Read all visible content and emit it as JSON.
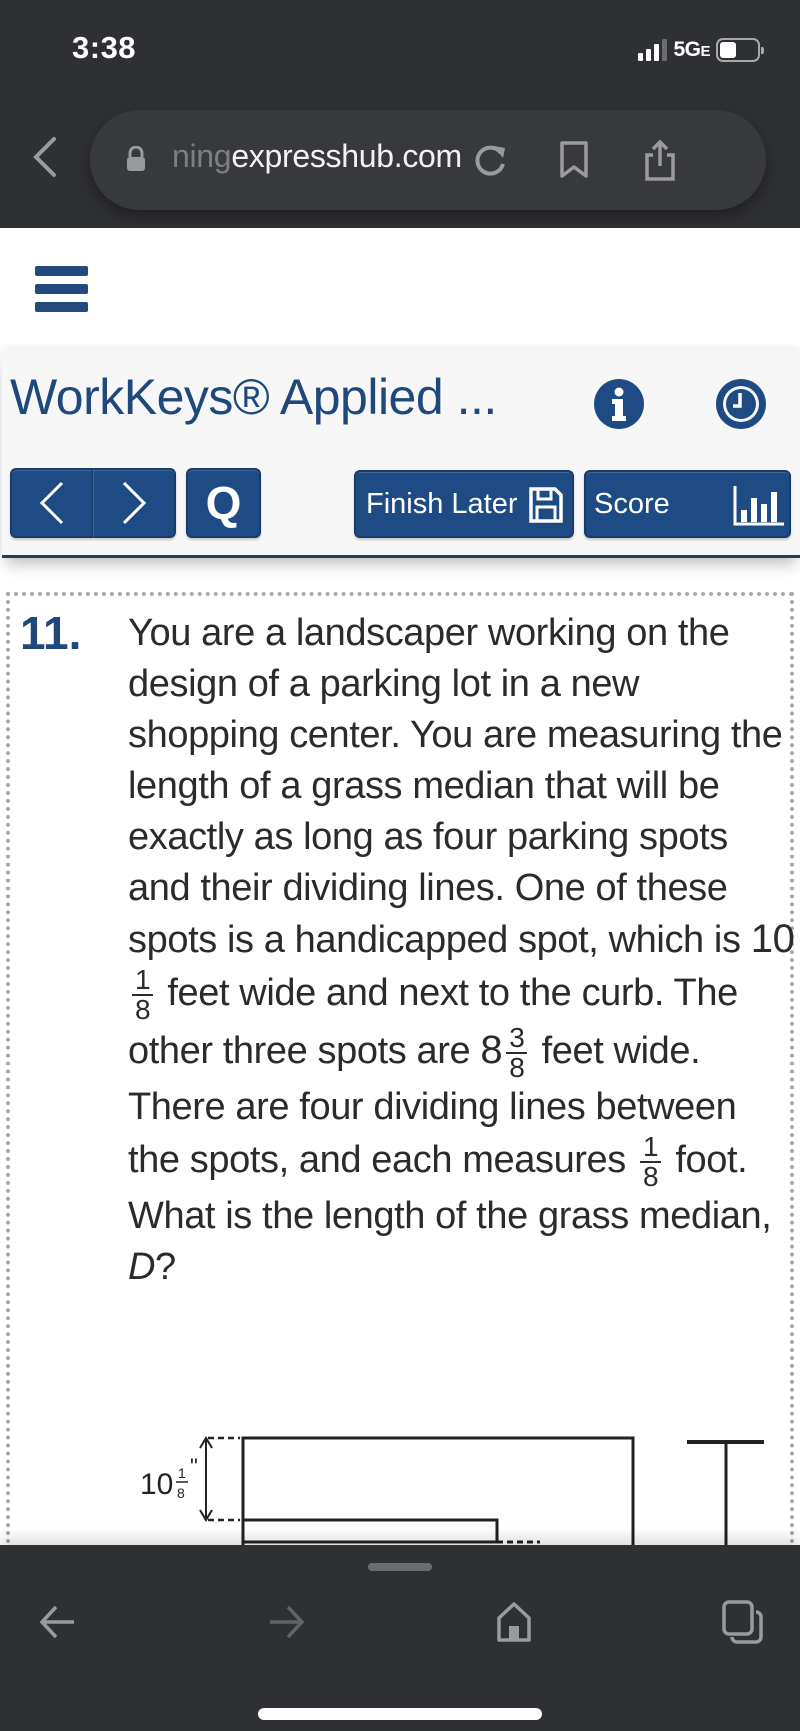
{
  "status_bar": {
    "time": "3:38",
    "network": "5G",
    "network_suffix": "E",
    "battery_level": 0.45
  },
  "browser": {
    "url_faded": "ning",
    "url_main": "expresshub.com",
    "icons": [
      "back-chevron-icon",
      "lock-icon",
      "reload-icon",
      "bookmark-icon",
      "share-icon"
    ]
  },
  "app": {
    "menu_icon": "hamburger-menu-icon",
    "title": "WorkKeys® Applied ...",
    "info_icon": "info-icon",
    "timer_icon": "clock-icon",
    "toolbar": {
      "prev_label": "previous",
      "next_label": "next",
      "q_label": "Q",
      "finish_later_label": "Finish Later",
      "score_label": "Score"
    },
    "colors": {
      "brand_blue": "#1f4b85",
      "title_blue": "#1f497d",
      "chrome_dark": "#2f3033"
    }
  },
  "question": {
    "number": "11.",
    "text_part1": "You are a landscaper working on the design of a parking lot in a new shopping center. You are measuring the length of a grass median that will be exactly as long as four parking spots and their dividing lines. One of these spots is a handicapped spot, which is ",
    "handicap_whole": "10",
    "handicap_num": "1",
    "handicap_den": "8",
    "text_part2": " feet wide and next to the curb. The other three spots are ",
    "spot_whole": "8",
    "spot_num": "3",
    "spot_den": "8",
    "text_part3": " feet wide. There are four dividing lines between the spots, and each measures ",
    "line_num": "1",
    "line_den": "8",
    "text_part4": " foot. What is the length of the grass median, ",
    "variable": "D",
    "text_part5": "?",
    "diagram": {
      "label_whole": "10",
      "label_num": "1",
      "label_den": "8",
      "label_unit": "\""
    }
  },
  "bottom_toolbar": {
    "icons": [
      "back-arrow-icon",
      "forward-arrow-icon",
      "home-icon",
      "tabs-icon"
    ]
  }
}
